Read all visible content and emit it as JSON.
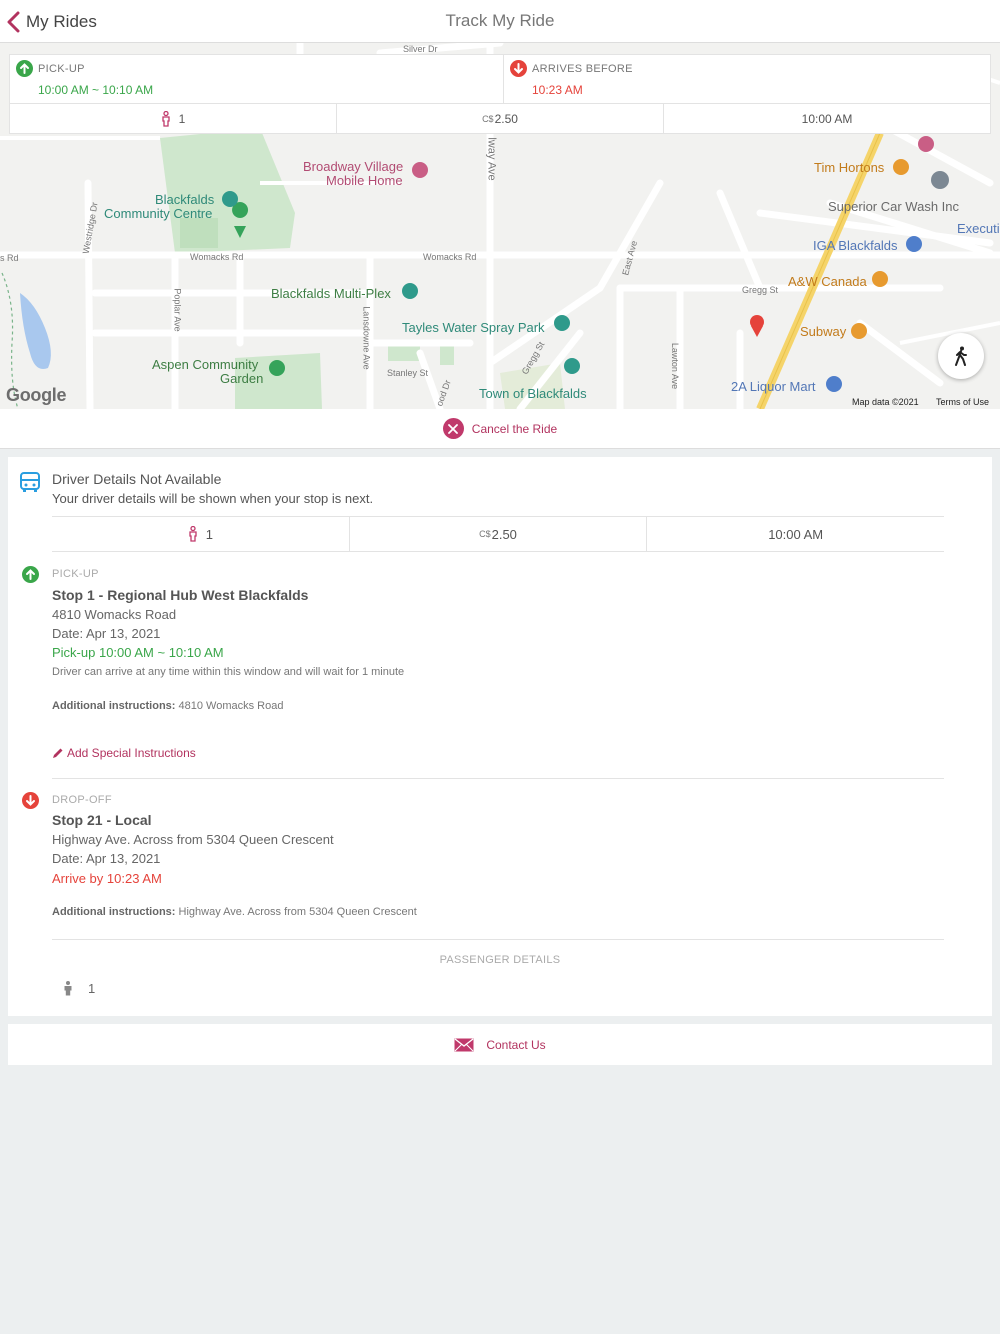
{
  "header": {
    "back_label": "My Rides",
    "title": "Track My Ride"
  },
  "map": {
    "labels": {
      "silver_dr": "Silver Dr",
      "broadway_line1": "Broadway Village",
      "broadway_line2": "Mobile Home",
      "blackfalds_cc_line1": "Blackfalds",
      "blackfalds_cc_line2": "Community Centre",
      "womacks_rd_left": "Womacks Rd",
      "womacks_rd_right": "Womacks Rd",
      "s_rd": "s Rd",
      "westridge_dr": "Westridge Dr",
      "poplar_ave": "Poplar Ave",
      "lansdowne_ave": "Lansdowne Ave",
      "highway_ave": "lway Ave",
      "east_ave": "East Ave",
      "gregg_st_diag": "Gregg St",
      "gregg_st": "Gregg St",
      "stanley_st": "Stanley St",
      "wood_dr": "ood Dr",
      "lawton_ave": "Lawton Ave",
      "multiplex": "Blackfalds Multi-Plex",
      "tayles": "Tayles Water Spray Park",
      "aspen_line1": "Aspen Community",
      "aspen_line2": "Garden",
      "town": "Town of Blackfalds",
      "tim_hortons": "Tim Hortons",
      "superior": "Superior Car Wash Inc",
      "execu": "Executi",
      "iga": "IGA Blackfalds",
      "aw": "A&W Canada",
      "subway": "Subway",
      "liquor": "2A Liquor Mart"
    },
    "google": "Google",
    "map_data": "Map data ©2021",
    "terms": "Terms of Use"
  },
  "summary": {
    "pickup_label": "PICK-UP",
    "pickup_window": "10:00 AM ~ 10:10 AM",
    "arrives_label": "ARRIVES BEFORE",
    "arrives_time": "10:23 AM",
    "passengers": "1",
    "currency": "C$",
    "fare": "2.50",
    "time": "10:00 AM"
  },
  "cancel_label": "Cancel the Ride",
  "driver": {
    "title": "Driver Details Not Available",
    "subtitle": "Your driver details will be shown when your stop is next."
  },
  "stats": {
    "passengers": "1",
    "currency": "C$",
    "fare": "2.50",
    "time": "10:00 AM"
  },
  "pickup": {
    "label": "PICK-UP",
    "stop": "Stop 1 - Regional Hub West Blackfalds",
    "address": "4810 Womacks Road",
    "date": "Date: Apr 13, 2021",
    "window": "Pick-up 10:00 AM ~ 10:10 AM",
    "note": "Driver can arrive at any time within this window and will wait for 1 minute",
    "instructions_label": "Additional instructions:",
    "instructions": "4810 Womacks Road",
    "add_special": "Add Special Instructions"
  },
  "dropoff": {
    "label": "DROP-OFF",
    "stop": "Stop 21 - Local",
    "address": "Highway Ave. Across from 5304 Queen Crescent",
    "date": "Date: Apr 13, 2021",
    "arrive": "Arrive by 10:23 AM",
    "instructions_label": "Additional instructions:",
    "instructions": "Highway Ave. Across from 5304 Queen Crescent"
  },
  "passenger_details": {
    "label": "PASSENGER DETAILS",
    "count": "1"
  },
  "contact_label": "Contact Us",
  "colors": {
    "accent": "#b2335f",
    "green": "#3aa64a",
    "red": "#e5433b",
    "bus_blue": "#2a9ee0"
  }
}
